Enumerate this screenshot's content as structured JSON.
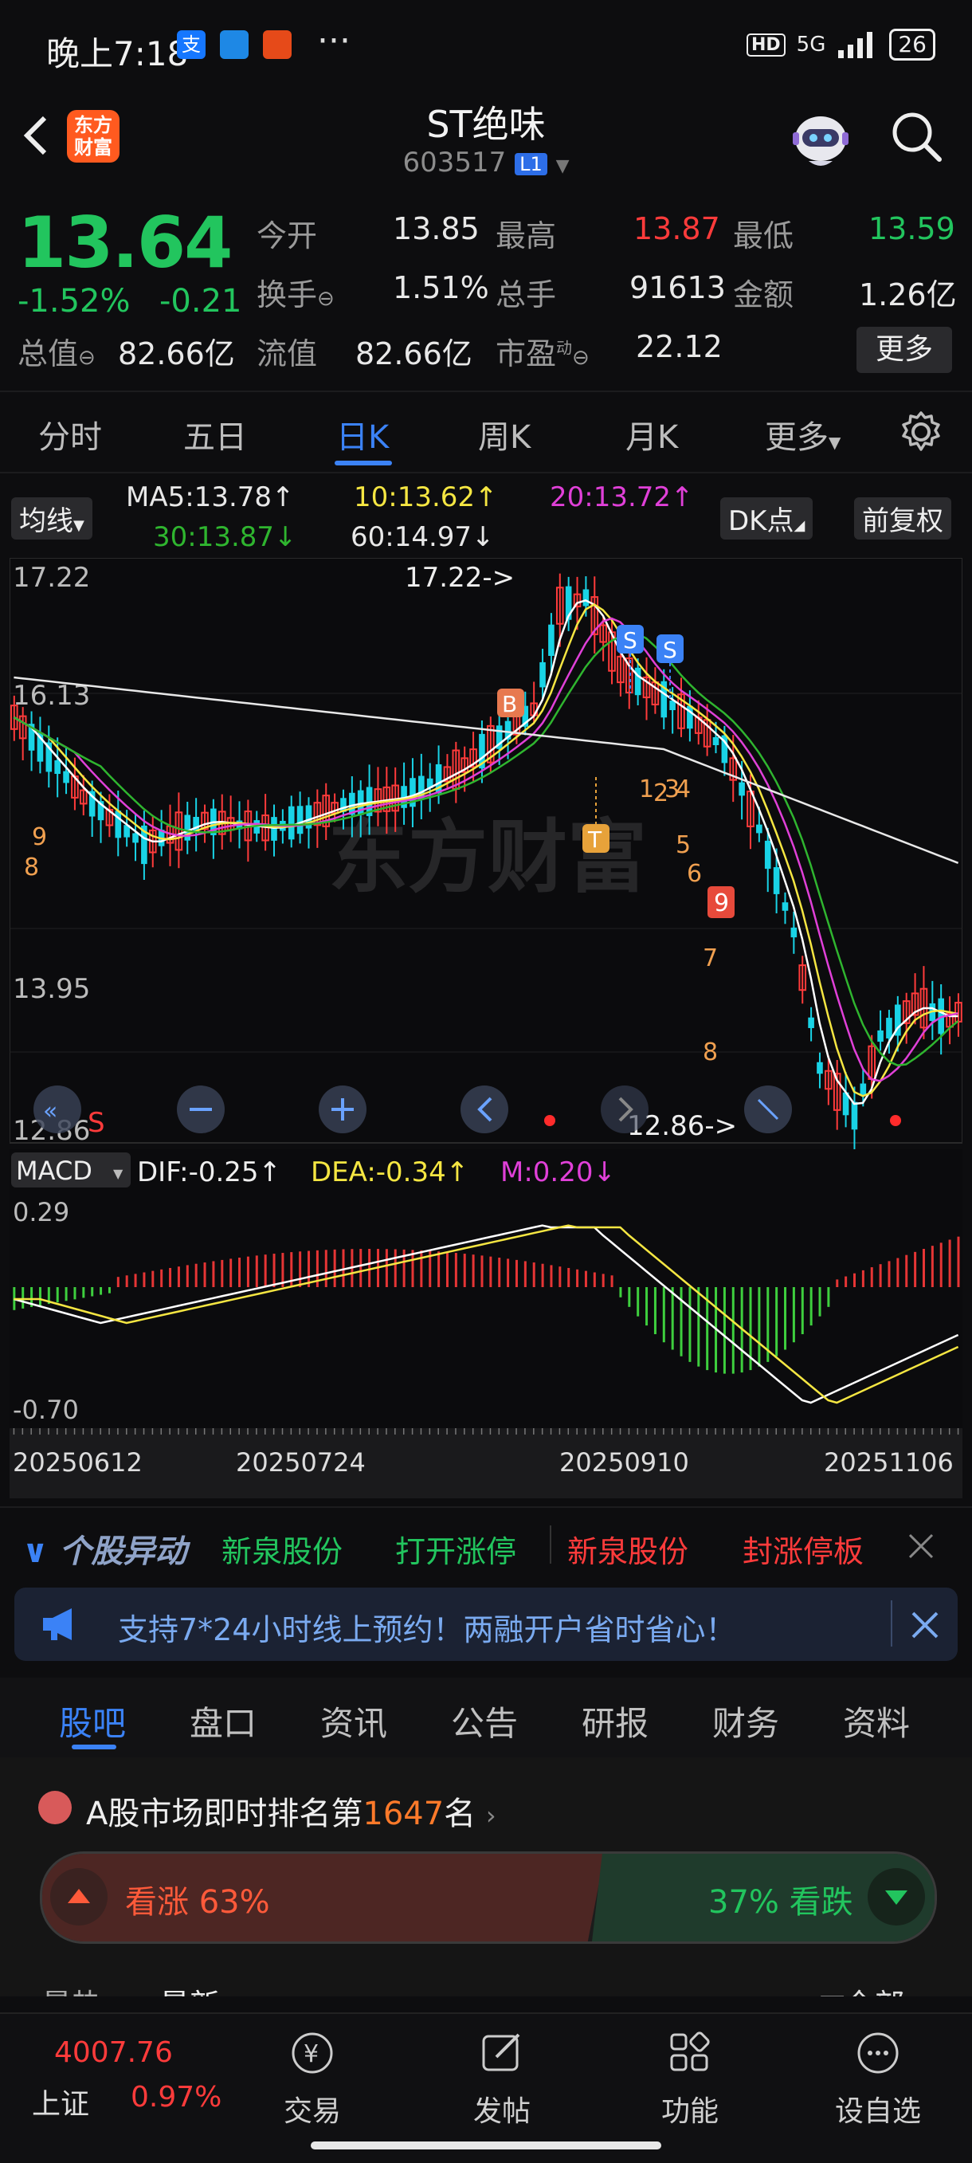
{
  "status_bar": {
    "time": "晚上7:18",
    "dots": "···",
    "hd": "HD",
    "net": "5G",
    "battery": "26"
  },
  "header": {
    "logo_line1": "东方",
    "logo_line2": "财富",
    "title": "ST绝味",
    "code": "603517",
    "level": "L1"
  },
  "quote": {
    "price": "13.64",
    "change_pct": "-1.52%",
    "change_abs": "-0.21",
    "open_label": "今开",
    "open": "13.85",
    "high_label": "最高",
    "high": "13.87",
    "low_label": "最低",
    "low": "13.59",
    "turnover_label": "换手",
    "turnover": "1.51%",
    "volume_label": "总手",
    "volume": "91613",
    "amount_label": "金额",
    "amount": "1.26亿",
    "mcap_label": "总值",
    "mcap": "82.66亿",
    "float_label": "流值",
    "float": "82.66亿",
    "pe_label": "市盈",
    "pe_sup": "动",
    "pe": "22.12",
    "more": "更多"
  },
  "ktabs": [
    "分时",
    "五日",
    "日K",
    "周K",
    "月K",
    "更多"
  ],
  "ma_bar": {
    "chip": "均线",
    "ma5": "MA5:13.78↑",
    "ma10": "10:13.62↑",
    "ma20": "20:13.72↑",
    "ma30": "30:13.87↓",
    "ma60": "60:14.97↓",
    "dk": "DK点",
    "adj": "前复权"
  },
  "chart_data": {
    "type": "candlestick",
    "y_ticks": [
      "17.22",
      "16.13",
      "13.95",
      "12.86"
    ],
    "high_marker": "17.22->",
    "low_marker": "12.86->",
    "watermark": "东方财富",
    "signals": [
      "S",
      "S",
      "B",
      "T"
    ],
    "seq_numbers": [
      "9",
      "8",
      "1",
      "2",
      "3",
      "4",
      "5",
      "6",
      "9",
      "7",
      "8"
    ],
    "macd": {
      "chip": "MACD",
      "dif": "DIF:-0.25↑",
      "dea": "DEA:-0.34↑",
      "m": "M:0.20↓",
      "y_top": "0.29",
      "y_bottom": "-0.70"
    },
    "x_labels": [
      "20250612",
      "20250724",
      "20250910",
      "20251106"
    ],
    "ylim": [
      12.86,
      17.22
    ]
  },
  "yidong": {
    "title": "个股异动",
    "items": [
      {
        "text": "新泉股份",
        "color": "#22c55e"
      },
      {
        "text": "打开涨停",
        "color": "#22c55e"
      },
      {
        "text": "新泉股份",
        "color": "#ff3b3b"
      },
      {
        "text": "封涨停板",
        "color": "#ff3b3b"
      }
    ]
  },
  "banner": {
    "text": "支持7*24小时线上预约！两融开户省时省心！"
  },
  "subtabs": [
    "股吧",
    "盘口",
    "资讯",
    "公告",
    "研报",
    "财务",
    "资料"
  ],
  "rank": {
    "prefix": "A股市场即时排名第",
    "num": "1647",
    "suffix": "名",
    "bull": "看涨 63%",
    "bear": "37% 看跌",
    "bull_pct": 63,
    "tab1": "最热",
    "tab2": "最新",
    "tab3": "全部"
  },
  "bottom_nav": {
    "index_value": "4007.76",
    "index_name": "上证",
    "index_pct": "0.97%",
    "items": [
      "交易",
      "发帖",
      "功能",
      "设自选"
    ]
  }
}
